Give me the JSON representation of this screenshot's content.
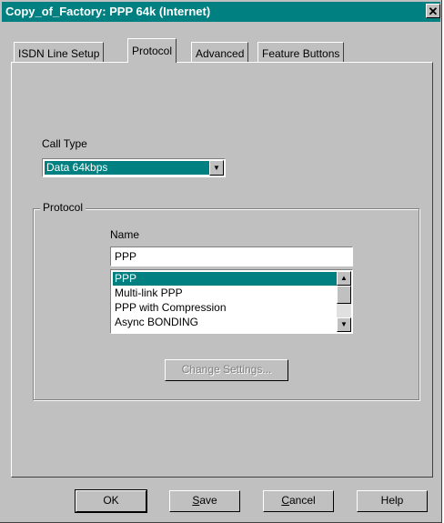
{
  "window": {
    "title": "Copy_of_Factory: PPP 64k (Internet)"
  },
  "tabs": [
    {
      "label": "ISDN Line Setup",
      "active": false
    },
    {
      "label": "Protocol",
      "active": true
    },
    {
      "label": "Advanced",
      "active": false
    },
    {
      "label": "Feature Buttons",
      "active": false
    }
  ],
  "call_type": {
    "label": "Call Type",
    "value": "Data 64kbps"
  },
  "protocol_group": {
    "title": "Protocol",
    "name_label": "Name",
    "name_value": "PPP",
    "options": [
      "PPP",
      "Multi-link PPP",
      "PPP with Compression",
      "Async BONDING"
    ],
    "selected": "PPP",
    "change_settings_label": "Change Settings..."
  },
  "buttons": {
    "ok": "OK",
    "save_first": "S",
    "save_rest": "ave",
    "cancel_first": "C",
    "cancel_rest": "ancel",
    "help": "Help"
  },
  "icons": {
    "close": "close-icon",
    "dropdown": "chevron-down-icon",
    "scroll_up": "arrow-up-icon",
    "scroll_down": "arrow-down-icon"
  },
  "colors": {
    "titlebar": "#008080",
    "dialog": "#c0c0c0",
    "selection": "#008080"
  }
}
